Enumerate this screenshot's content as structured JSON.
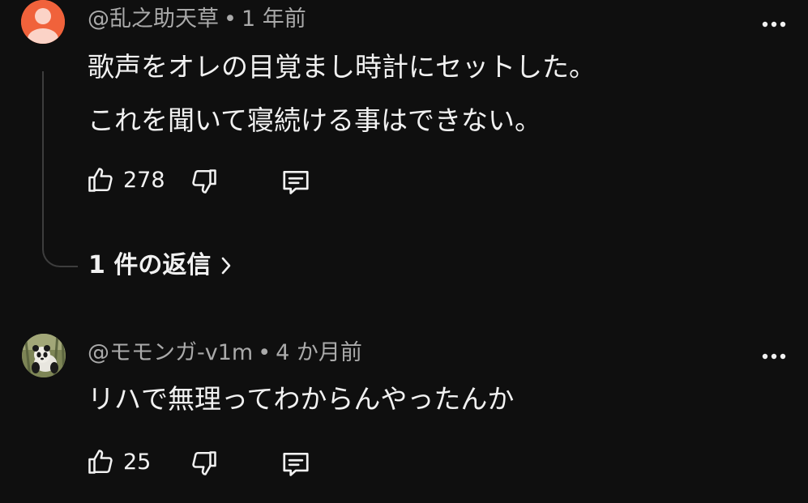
{
  "comments": [
    {
      "author": "@乱之助天草",
      "separator": "•",
      "time": "1 年前",
      "lines": [
        "歌声をオレの目覚まし時計にセットした。",
        "これを聞いて寝続ける事はできない。"
      ],
      "likes": "278",
      "avatar_color": "#f0623b",
      "avatar_icon": "default-person-icon",
      "replies_label": "1 件の返信"
    },
    {
      "author": "@モモンガ-v1m",
      "separator": "•",
      "time": "4 か月前",
      "lines": [
        "リハで無理ってわからんやったんか"
      ],
      "likes": "25",
      "avatar_icon": "panda-photo"
    }
  ],
  "icons": {
    "like": "thumb-up-icon",
    "dislike": "thumb-down-icon",
    "reply": "comment-reply-icon",
    "menu": "more-vertical-dots-icon",
    "chevron": "chevron-right-icon"
  },
  "colors": {
    "background": "#0f0f0f",
    "text": "#f1f1f1",
    "meta": "#aaaaaa",
    "thread_line": "#3d3d3d"
  }
}
